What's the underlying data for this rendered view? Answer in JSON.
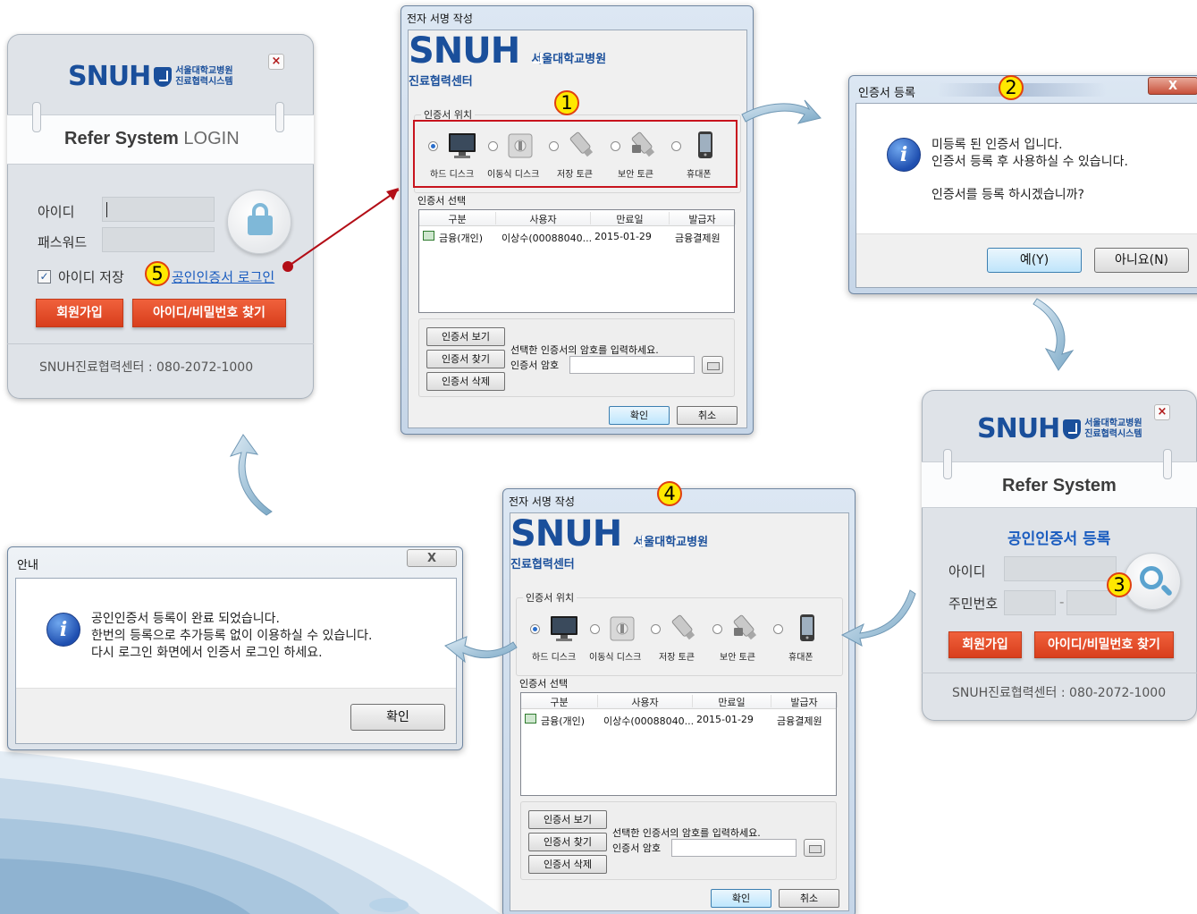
{
  "brand": {
    "name": "SNUH",
    "sub1_login": "서울대학교병원",
    "sub2_login": "진료협력시스템",
    "sub1_cert": "서울대학교병원",
    "sub2_cert": "진료협력센터"
  },
  "login": {
    "close": "×",
    "title": "Refer System",
    "title_suffix": "LOGIN",
    "id_label": "아이디",
    "pw_label": "패스워드",
    "save_id_label": "아이디 저장",
    "save_id_checked": true,
    "cert_login_link": "공인인증서 로그인",
    "signup_button": "회원가입",
    "find_button": "아이디/비밀번호 찾기",
    "footer": "SNUH진료협력센터 : 080-2072-1000"
  },
  "register": {
    "close": "×",
    "title": "Refer System",
    "heading": "공인인증서 등록",
    "id_label": "아이디",
    "rrn_label": "주민번호",
    "rrn_sep": "-",
    "signup_button": "회원가입",
    "find_button": "아이디/비밀번호 찾기",
    "footer": "SNUH진료협력센터 : 080-2072-1000"
  },
  "signing_dialog": {
    "title": "전자 서명 작성",
    "location_group": "인증서 위치",
    "devices": [
      "하드 디스크",
      "이동식 디스크",
      "저장 토큰",
      "보안 토큰",
      "휴대폰"
    ],
    "selected_device": 0,
    "cert_select_label": "인증서 선택",
    "columns": [
      "구분",
      "사용자",
      "만료일",
      "발급자"
    ],
    "rows": [
      [
        "금융(개인)",
        "이상수(00088040...",
        "2015-01-29",
        "금융결제원"
      ]
    ],
    "view_button": "인증서 보기",
    "find_button": "인증서 찾기",
    "delete_button": "인증서 삭제",
    "hint": "선택한 인증서의 암호를 입력하세요.",
    "password_label": "인증서 암호",
    "ok_button": "확인",
    "cancel_button": "취소"
  },
  "register_prompt": {
    "title": "인증서 등록",
    "close": "X",
    "line1": "미등록 된 인증서 입니다.",
    "line2": "인증서 등록 후 사용하실 수 있습니다.",
    "question": "인증서를 등록 하시겠습니까?",
    "yes_button": "예(Y)",
    "no_button": "아니요(N)"
  },
  "notice_dialog": {
    "title": "안내",
    "close": "X",
    "line1": "공인인증서 등록이 완료 되었습니다.",
    "line2": "한번의 등록으로 추가등록 없이 이용하실 수 있습니다.",
    "line3": "다시 로그인 화면에서 인증서 로그인 하세요.",
    "ok_button": "확인"
  },
  "steps": [
    "1",
    "2",
    "3",
    "4",
    "5"
  ],
  "colors": {
    "accent_red": "#d83e1c",
    "brand_blue": "#1a4f9b",
    "step_badge": "#ffe800",
    "highlight_box": "#c8141e",
    "flow_arrow": "#8fb7cf"
  }
}
